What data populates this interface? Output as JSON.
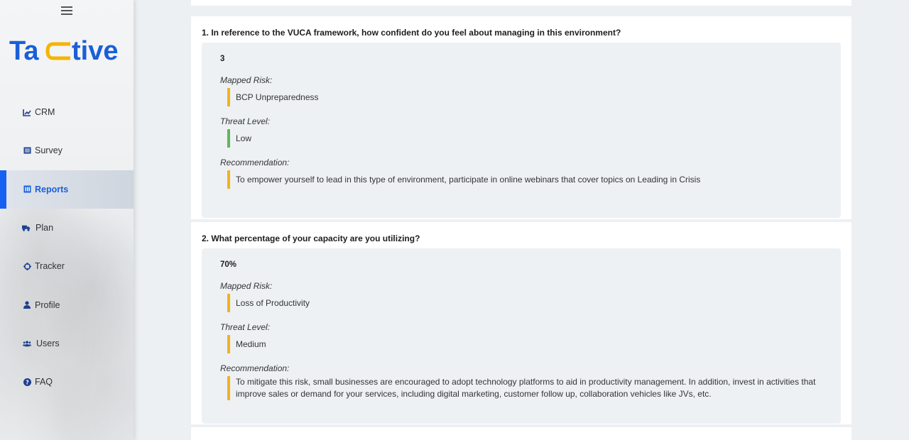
{
  "sidebar": {
    "logo_text": "Tactive",
    "items": [
      {
        "label": "CRM",
        "icon": "chart-line-icon"
      },
      {
        "label": "Survey",
        "icon": "list-icon"
      },
      {
        "label": "Reports",
        "icon": "report-icon",
        "active": true
      },
      {
        "label": "Plan",
        "icon": "truck-icon"
      },
      {
        "label": "Tracker",
        "icon": "crosshair-icon"
      },
      {
        "label": "Profile",
        "icon": "user-icon"
      },
      {
        "label": "Users",
        "icon": "users-icon"
      },
      {
        "label": "FAQ",
        "icon": "question-circle-icon"
      }
    ]
  },
  "questions": [
    {
      "title": "1. In reference to the VUCA framework, how confident do you feel about managing in this environment?",
      "answer": "3",
      "mapped_risk_label": "Mapped Risk:",
      "mapped_risk": "BCP Unpreparedness",
      "threat_level_label": "Threat Level:",
      "threat_level": "Low",
      "recommendation_label": "Recommendation:",
      "recommendation": "To empower yourself to lead in this type of environment, participate in online webinars that cover topics on Leading in Crisis"
    },
    {
      "title": "2. What percentage of your capacity are you utilizing?",
      "answer": "70%",
      "mapped_risk_label": "Mapped Risk:",
      "mapped_risk": "Loss of Productivity",
      "threat_level_label": "Threat Level:",
      "threat_level": "Medium",
      "recommendation_label": "Recommendation:",
      "recommendation": "To mitigate this risk, small businesses are encouraged to adopt technology platforms to aid in productivity management. In addition, invest in activities that improve sales or demand for your services, including digital marketing, customer follow up, collaboration vehicles like JVs, etc."
    }
  ],
  "colors": {
    "accent": "#1660f2",
    "logo_blue": "#1a5fd8",
    "logo_yellow": "#f5b400",
    "bar_yellow": "#f1b31c",
    "bar_green": "#5cb85c"
  }
}
